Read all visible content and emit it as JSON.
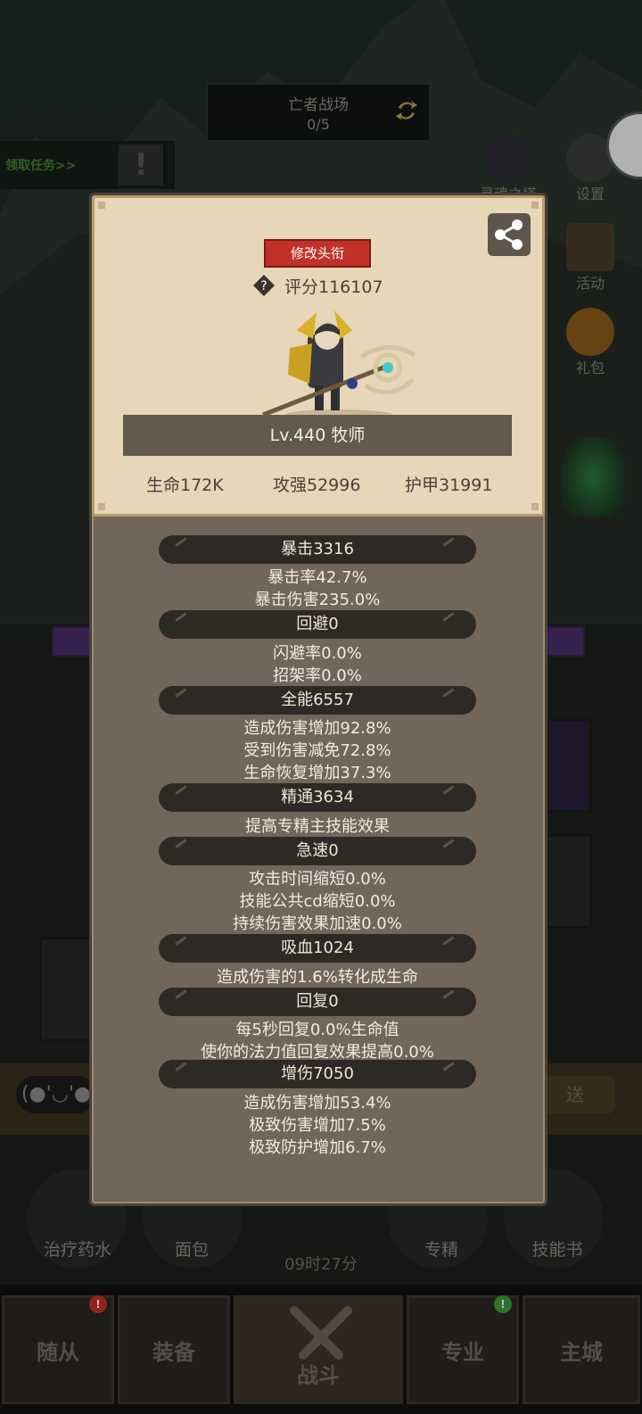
{
  "background": {
    "banner": {
      "title": "亡者战场",
      "progress": "0/5"
    },
    "task_label": "领取任务>>",
    "side_menu": [
      {
        "label": "灵魂之塔",
        "icon": "tower-icon"
      },
      {
        "label": "设置",
        "icon": "gear-icon"
      },
      {
        "label": "活动",
        "icon": "scroll-icon"
      },
      {
        "label": "礼包",
        "icon": "gift-icon"
      }
    ],
    "chat": {
      "emote": "(●'◡'●",
      "send": "送"
    },
    "skills": [
      {
        "label": "治疗药水",
        "icon": "potion-icon"
      },
      {
        "label": "面包",
        "icon": "bread-icon"
      },
      {
        "label": "专精",
        "icon": "spec-icon"
      },
      {
        "label": "技能书",
        "icon": "book-icon"
      }
    ],
    "timer": "09时27分",
    "nav": [
      {
        "label": "随从",
        "badge": "!"
      },
      {
        "label": "装备",
        "badge": ""
      },
      {
        "label": "战斗",
        "badge": ""
      },
      {
        "label": "专业",
        "badge": "!"
      },
      {
        "label": "主城",
        "badge": ""
      }
    ]
  },
  "profile": {
    "title_button": "修改头衔",
    "score": "评分116107",
    "level_class": "Lv.440 牧师",
    "base_stats": {
      "hp": "生命172K",
      "attack": "攻强52996",
      "armor": "护甲31991"
    }
  },
  "stats": [
    {
      "head": "暴击3316",
      "lines": [
        "暴击率42.7%",
        "暴击伤害235.0%"
      ]
    },
    {
      "head": "回避0",
      "lines": [
        "闪避率0.0%",
        "招架率0.0%"
      ]
    },
    {
      "head": "全能6557",
      "lines": [
        "造成伤害增加92.8%",
        "受到伤害减免72.8%",
        "生命恢复增加37.3%"
      ]
    },
    {
      "head": "精通3634",
      "lines": [
        "提高专精主技能效果"
      ]
    },
    {
      "head": "急速0",
      "lines": [
        "攻击时间缩短0.0%",
        "技能公共cd缩短0.0%",
        "持续伤害效果加速0.0%"
      ]
    },
    {
      "head": "吸血1024",
      "lines": [
        "造成伤害的1.6%转化成生命"
      ]
    },
    {
      "head": "回复0",
      "lines": [
        "每5秒回复0.0%生命值",
        "使你的法力值回复效果提高0.0%"
      ]
    },
    {
      "head": "增伤7050",
      "lines": [
        "造成伤害增加53.4%",
        "极致伤害增加7.5%",
        "极致防护增加6.7%"
      ]
    }
  ],
  "colors": {
    "accent_red": "#c13128",
    "parchment": "#e7d6b8",
    "panel": "#72655a",
    "badge_red": "#c0302a",
    "badge_green": "#3c9a3a"
  }
}
